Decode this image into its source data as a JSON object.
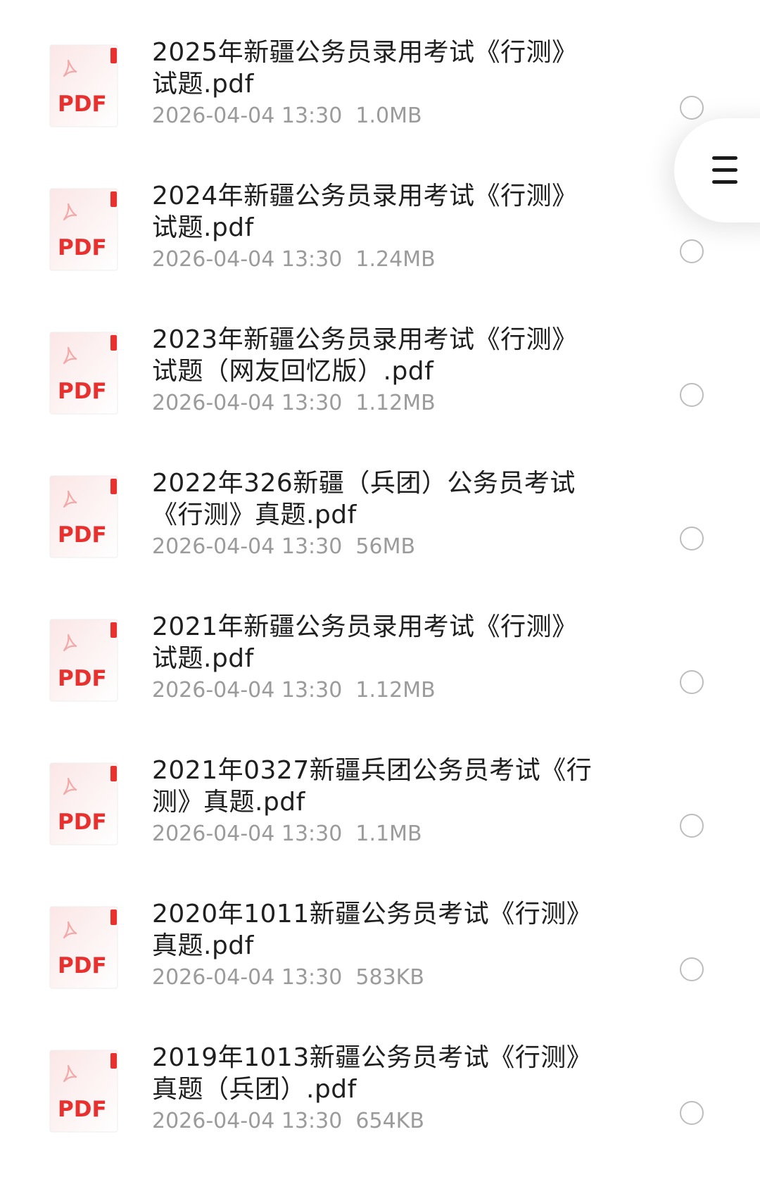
{
  "files": [
    {
      "name": "2025年新疆公务员录用考试《行测》试题.pdf",
      "date": "2026-04-04 13:30",
      "size": "1.0MB",
      "icon_label": "PDF"
    },
    {
      "name": "2024年新疆公务员录用考试《行测》试题.pdf",
      "date": "2026-04-04 13:30",
      "size": "1.24MB",
      "icon_label": "PDF"
    },
    {
      "name": "2023年新疆公务员录用考试《行测》试题（网友回忆版）.pdf",
      "date": "2026-04-04 13:30",
      "size": "1.12MB",
      "icon_label": "PDF"
    },
    {
      "name": "2022年326新疆（兵团）公务员考试《行测》真题.pdf",
      "date": "2026-04-04 13:30",
      "size": "56MB",
      "icon_label": "PDF"
    },
    {
      "name": "2021年新疆公务员录用考试《行测》试题.pdf",
      "date": "2026-04-04 13:30",
      "size": "1.12MB",
      "icon_label": "PDF"
    },
    {
      "name": "2021年0327新疆兵团公务员考试《行测》真题.pdf",
      "date": "2026-04-04 13:30",
      "size": "1.1MB",
      "icon_label": "PDF"
    },
    {
      "name": "2020年1011新疆公务员考试《行测》真题.pdf",
      "date": "2026-04-04 13:30",
      "size": "583KB",
      "icon_label": "PDF"
    },
    {
      "name": "2019年1013新疆公务员考试《行测》真题（兵团）.pdf",
      "date": "2026-04-04 13:30",
      "size": "654KB",
      "icon_label": "PDF"
    }
  ],
  "icons": {
    "file": "pdf-file-icon",
    "select": "radio-circle",
    "menu": "hamburger-menu-icon"
  },
  "colors": {
    "pdf_red": "#e8312f",
    "title_text": "#1f1f1f",
    "meta_text": "#9b9b9b",
    "circle_border": "#bdbdbd"
  }
}
